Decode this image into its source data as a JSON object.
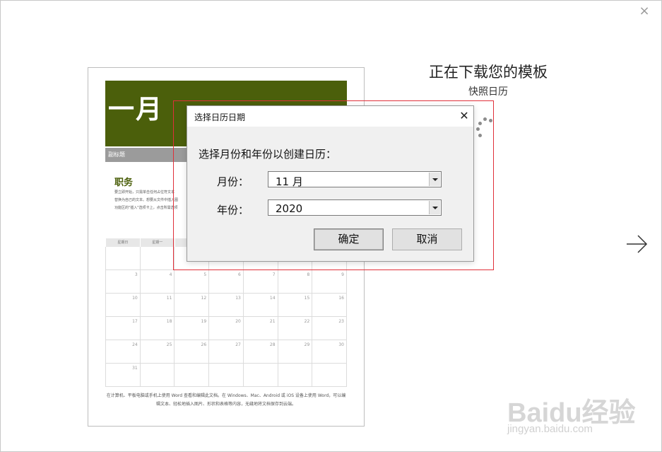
{
  "window": {
    "close_glyph": "×"
  },
  "download": {
    "title": "正在下载您的模板",
    "subtitle": "快照日历"
  },
  "preview": {
    "month": "一月",
    "subtitle_label": "副标题",
    "section_heading": "职务",
    "body_text": [
      "要立即开始，只需单击任何占位符文本",
      "替换为自己的文本。想要从文件中插入图",
      "功能区的\"插入\"选项卡上，点击所需选项"
    ],
    "weekday_labels": [
      "星期日",
      "星期一",
      "",
      "",
      "",
      "",
      ""
    ],
    "day_cells": [
      "",
      "",
      "",
      "",
      "",
      "",
      "",
      "3",
      "4",
      "5",
      "6",
      "7",
      "8",
      "9",
      "10",
      "11",
      "12",
      "13",
      "14",
      "15",
      "16",
      "17",
      "18",
      "19",
      "20",
      "21",
      "22",
      "23",
      "24",
      "25",
      "26",
      "27",
      "28",
      "29",
      "30",
      "31",
      "",
      "",
      "",
      "",
      "",
      ""
    ],
    "footer_text": "在计算机、平板电脑或手机上使用 Word 查看和编辑此文档。在 Windows、Mac、Android 或 iOS 设备上使用 Word，可以编辑文本、轻松地插入图片、形状和表格等内容，无缝地将文档保存到云端。"
  },
  "dialog": {
    "title": "选择日历日期",
    "close_glyph": "✕",
    "prompt": "选择月份和年份以创建日历：",
    "month_label": "月份：",
    "month_value": "11 月",
    "year_label": "年份：",
    "year_value": "2020",
    "ok_label": "确定",
    "cancel_label": "取消"
  },
  "watermark": {
    "logo": "Baidu经验",
    "url": "jingyan.baidu.com"
  },
  "colors": {
    "banner": "#4b5f0b",
    "highlight": "#e0303a",
    "dialog_bg": "#f0f0f0"
  },
  "icons": {
    "close": "close-icon",
    "next": "arrow-right-icon",
    "spinner": "loading-spinner-icon",
    "dropdown": "chevron-down-icon"
  }
}
